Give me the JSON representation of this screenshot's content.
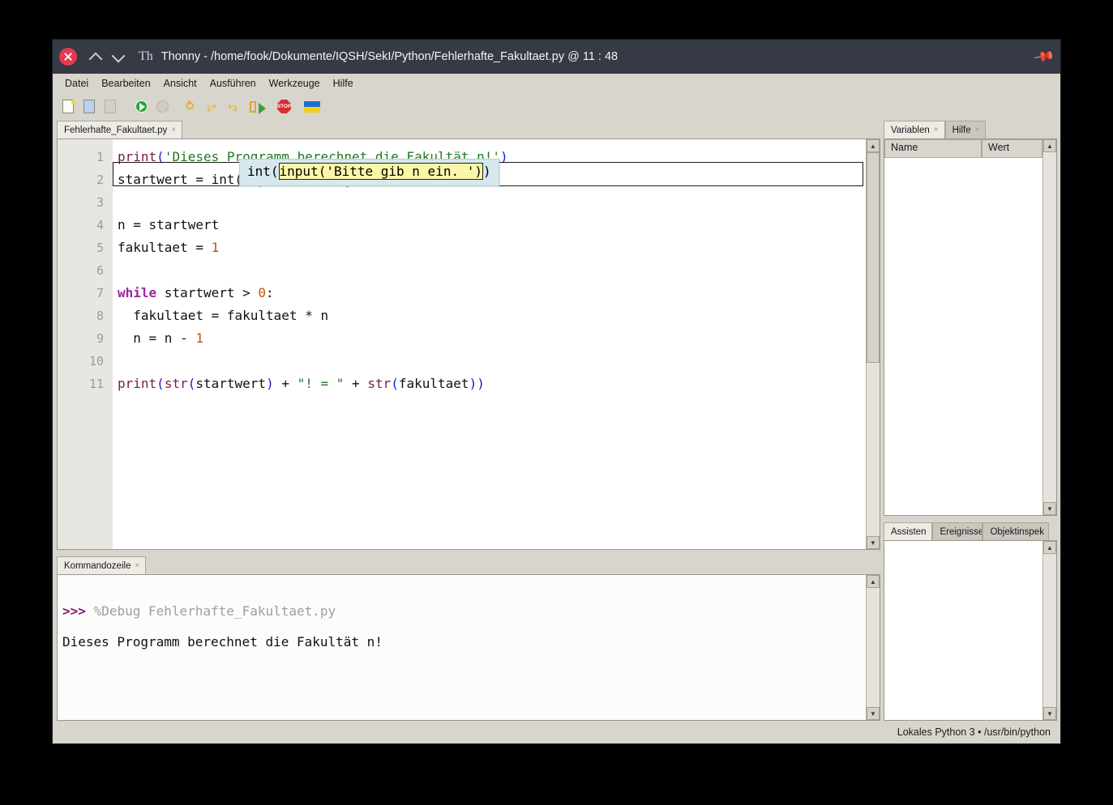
{
  "window": {
    "title": "Thonny - /home/fook/Dokumente/IQSH/SekI/Python/Fehlerhafte_Fakultaet.py @ 11 : 48",
    "app_icon": "Th",
    "close_icon": "close-icon",
    "pin_icon": "📌"
  },
  "menubar": {
    "items": [
      "Datei",
      "Bearbeiten",
      "Ansicht",
      "Ausführen",
      "Werkzeuge",
      "Hilfe"
    ]
  },
  "toolbar": {
    "buttons": [
      {
        "name": "new-file",
        "label": "Neu"
      },
      {
        "name": "open-file",
        "label": "Öffnen"
      },
      {
        "name": "save-file",
        "label": "Speichern"
      },
      {
        "name": "run",
        "label": "Ausführen"
      },
      {
        "name": "debug",
        "label": "Debuggen"
      },
      {
        "name": "step-over",
        "label": "Schritt über"
      },
      {
        "name": "step-into",
        "label": "Schritt hinein"
      },
      {
        "name": "step-out",
        "label": "Schritt heraus"
      },
      {
        "name": "resume",
        "label": "Fortsetzen"
      },
      {
        "name": "stop",
        "label": "STOP"
      },
      {
        "name": "ukraine-flag",
        "label": "Ukraine"
      }
    ],
    "stop_label": "STOP"
  },
  "editor": {
    "tab_label": "Fehlerhafte_Fakultaet.py",
    "tab_close": "×",
    "line_numbers": [
      "1",
      "2",
      "3",
      "4",
      "5",
      "6",
      "7",
      "8",
      "9",
      "10",
      "11"
    ],
    "lines": [
      "print('Dieses Programm berechnet die Fakultät n!')",
      "startwert = int(input('Bitte gib n ein. '))",
      "",
      "n = startwert",
      "fakultaet = 1",
      "",
      "while startwert > 0:",
      "  fakultaet = fakultaet * n",
      "  n = n - 1",
      "",
      "print(str(startwert) + \"! = \" + str(fakultaet))"
    ],
    "current_line": 2,
    "debug_overlay": {
      "prefix": "int(",
      "highlighted": "input('Bitte gib n ein. ')",
      "suffix": ")",
      "bg_color": "#d6e8ee",
      "highlight_color": "#fbf6a8"
    }
  },
  "shell": {
    "tab_label": "Kommandozeile",
    "tab_close": "×",
    "prompt": ">>>",
    "command": "%Debug Fehlerhafte_Fakultaet.py",
    "output": "Dieses Programm berechnet die Fakultät n!"
  },
  "variables_panel": {
    "tabs": [
      {
        "label": "Variablen",
        "active": true,
        "close": "×"
      },
      {
        "label": "Hilfe",
        "active": false,
        "close": "×"
      }
    ],
    "columns": [
      "Name",
      "Wert"
    ],
    "rows": []
  },
  "assistant_panel": {
    "tabs": [
      {
        "label": "Assisten",
        "active": true
      },
      {
        "label": "Ereignisse",
        "active": false
      },
      {
        "label": "Objektinspek",
        "active": false
      }
    ]
  },
  "statusbar": {
    "text": "Lokales Python 3  •  /usr/bin/python"
  },
  "scroll": {
    "up_arrow": "▲",
    "down_arrow": "▼"
  }
}
